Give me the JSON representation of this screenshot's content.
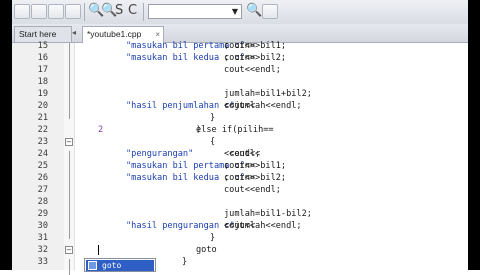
{
  "toolbar": {
    "combo_value": "",
    "buttons": [
      "undo",
      "redo",
      "cut",
      "copy",
      "paste",
      "zoom-in",
      "zoom-out",
      "find",
      "replace",
      "syntax-check",
      "compile"
    ]
  },
  "tabs": [
    {
      "label": "Start here",
      "active": false
    },
    {
      "label": "*youtube1.cpp",
      "active": true,
      "close": "×"
    }
  ],
  "editor": {
    "lines": [
      {
        "n": "15",
        "parts": [
          {
            "t": "cout<<",
            "c": "code"
          },
          {
            "t": "\"masukan bil pertama :\"",
            "c": "str"
          },
          {
            "t": "; cin>>bil1;",
            "c": "code"
          }
        ],
        "indent": 3
      },
      {
        "n": "16",
        "parts": [
          {
            "t": "cout<<",
            "c": "code"
          },
          {
            "t": "\"masukan bil kedua   :\"",
            "c": "str"
          },
          {
            "t": "; cin>>bil2;",
            "c": "code"
          }
        ],
        "indent": 3
      },
      {
        "n": "17",
        "parts": [
          {
            "t": "cout<<endl;",
            "c": "code"
          }
        ],
        "indent": 3
      },
      {
        "n": "18",
        "parts": [],
        "indent": 0
      },
      {
        "n": "19",
        "parts": [
          {
            "t": "jumlah=bil1+bil2;",
            "c": "code"
          }
        ],
        "indent": 3
      },
      {
        "n": "20",
        "parts": [
          {
            "t": "cout<<",
            "c": "code"
          },
          {
            "t": "\"hasil penjumlahan :\"",
            "c": "str"
          },
          {
            "t": "<<jumlah<<endl;",
            "c": "code"
          }
        ],
        "indent": 3
      },
      {
        "n": "21",
        "parts": [
          {
            "t": "}",
            "c": "code"
          }
        ],
        "indent": 2
      },
      {
        "n": "22",
        "parts": [
          {
            "t": "else if(pilih==",
            "c": "code"
          },
          {
            "t": "2",
            "c": "num"
          },
          {
            "t": ")",
            "c": "code"
          }
        ],
        "indent": 1
      },
      {
        "n": "23",
        "parts": [
          {
            "t": "{",
            "c": "code"
          }
        ],
        "indent": 2
      },
      {
        "n": "24",
        "parts": [
          {
            "t": " cout<<",
            "c": "code"
          },
          {
            "t": "\"pengurangan\"",
            "c": "str"
          },
          {
            "t": "<<endl;",
            "c": "code"
          }
        ],
        "indent": 3
      },
      {
        "n": "25",
        "parts": [
          {
            "t": "cout<<",
            "c": "code"
          },
          {
            "t": "\"masukan bil pertama :\"",
            "c": "str"
          },
          {
            "t": "; cin>>bil1;",
            "c": "code"
          }
        ],
        "indent": 3
      },
      {
        "n": "26",
        "parts": [
          {
            "t": "cout<<",
            "c": "code"
          },
          {
            "t": "\"masukan bil kedua   :\"",
            "c": "str"
          },
          {
            "t": "; cin>>bil2;",
            "c": "code"
          }
        ],
        "indent": 3
      },
      {
        "n": "27",
        "parts": [
          {
            "t": "cout<<endl;",
            "c": "code"
          }
        ],
        "indent": 3
      },
      {
        "n": "28",
        "parts": [],
        "indent": 0
      },
      {
        "n": "29",
        "parts": [
          {
            "t": "jumlah=bil1-bil2;",
            "c": "code"
          }
        ],
        "indent": 3
      },
      {
        "n": "30",
        "parts": [
          {
            "t": "cout<<",
            "c": "code"
          },
          {
            "t": "\"hasil pengurangan :\"",
            "c": "str"
          },
          {
            "t": "<<jumlah<<endl;",
            "c": "code"
          }
        ],
        "indent": 3
      },
      {
        "n": "31",
        "parts": [
          {
            "t": "}",
            "c": "code"
          }
        ],
        "indent": 2
      },
      {
        "n": "32",
        "parts": [
          {
            "t": "goto",
            "c": "code"
          }
        ],
        "indent": 1
      },
      {
        "n": "33",
        "parts": [
          {
            "t": "}",
            "c": "code"
          }
        ],
        "indent": 0
      }
    ]
  },
  "autocomplete": {
    "item": "goto"
  },
  "colors": {
    "string": "#1a3fb0",
    "number": "#7a3fb3",
    "selection": "#2f5fc4"
  }
}
